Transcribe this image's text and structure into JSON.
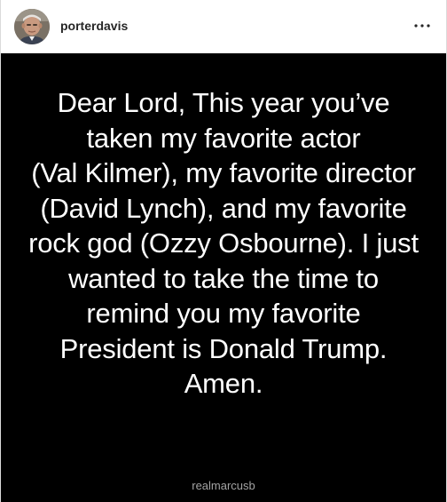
{
  "header": {
    "username": "porterdavis",
    "avatar_icon": "profile-photo",
    "more_icon": "more-options-icon"
  },
  "post_image": {
    "lines": [
      "Dear Lord, This year you’ve",
      "taken my favorite actor",
      "(Val Kilmer), my favorite director",
      "(David Lynch), and my favorite",
      "rock god (Ozzy Osbourne). I just",
      "wanted to take the time to",
      "remind you my favorite",
      "President is Donald Trump.",
      "Amen."
    ],
    "watermark": "realmarcusb"
  },
  "colors": {
    "image_background": "#000000",
    "image_text": "#ffffff",
    "username": "#262626",
    "watermark": "#a3a3a3"
  }
}
